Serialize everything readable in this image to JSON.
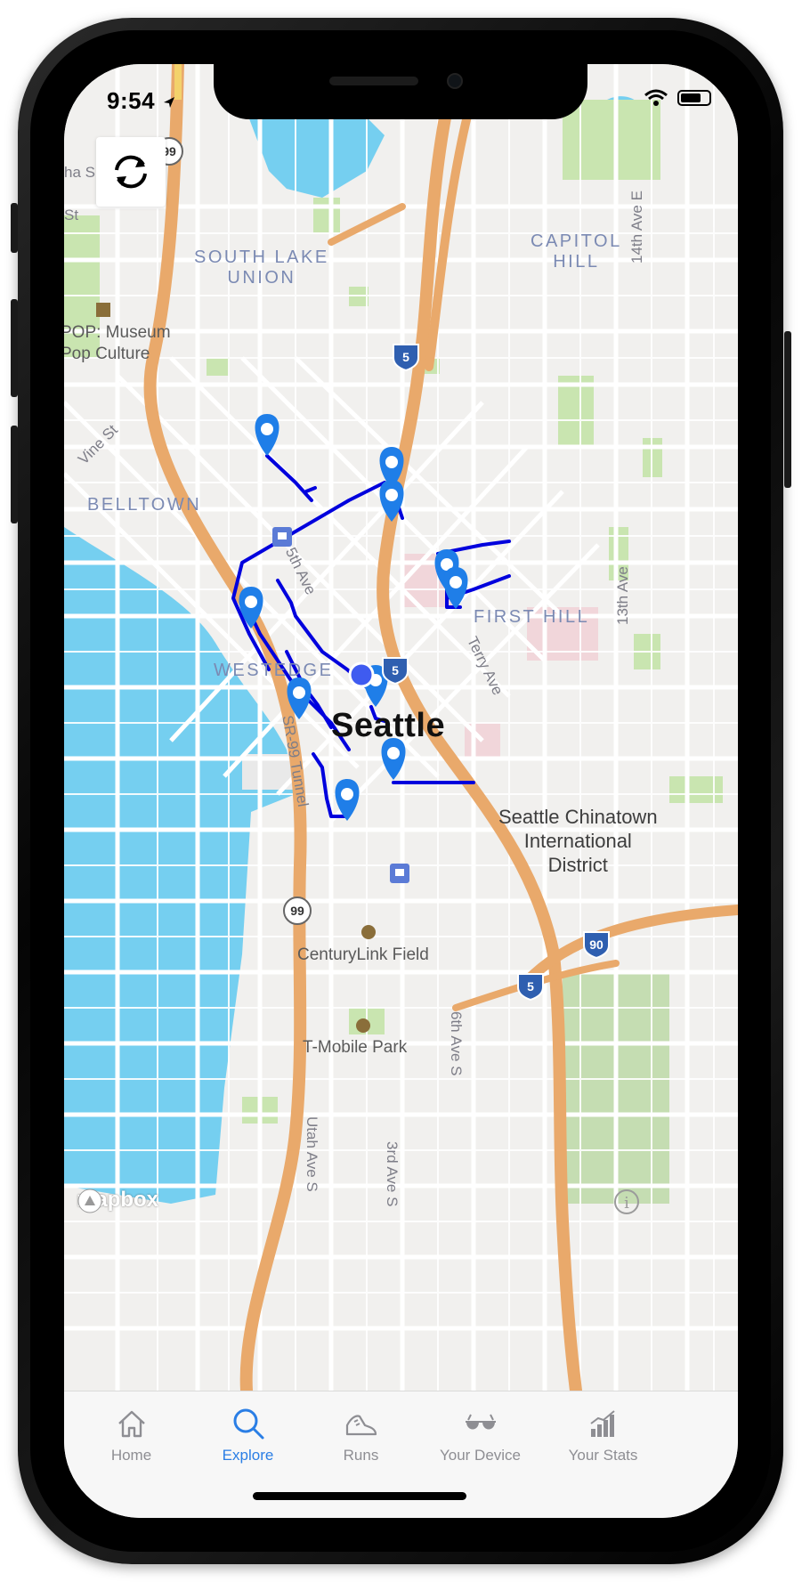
{
  "status_bar": {
    "time": "9:54"
  },
  "map": {
    "neighborhoods": [
      "SOUTH LAKE\nUNION",
      "CAPITOL\nHILL",
      "BELLTOWN",
      "FIRST HILL",
      "WESTEDGE"
    ],
    "streets": [
      "Vine St",
      "5th Ave",
      "Terry Ave",
      "13th Ave",
      "14th Ave E",
      "SR-99 Tunnel",
      "6th Ave S",
      "Utah Ave S",
      "3rd Ave S",
      "ha S",
      "St"
    ],
    "pois": [
      "POP: Museum\nPop Culture",
      "CenturyLink Field",
      "T-Mobile Park"
    ],
    "city_label": "Seattle",
    "district_label": "Seattle Chinatown\nInternational\nDistrict",
    "highway_shields": [
      "99",
      "5",
      "5",
      "99",
      "90",
      "5"
    ],
    "attribution": "mapbox",
    "info": "i"
  },
  "colors": {
    "accent": "#2a7ee5",
    "route": "#0000dd",
    "marker": "#1f7ee8",
    "highway": "#e9a96b",
    "water": "#75cff0",
    "park": "#c9e5b0"
  },
  "tabs": [
    {
      "label": "Home",
      "icon": "house-icon"
    },
    {
      "label": "Explore",
      "icon": "magnifier-icon",
      "active": true
    },
    {
      "label": "Runs",
      "icon": "shoe-icon"
    },
    {
      "label": "Your Device",
      "icon": "glasses-icon"
    },
    {
      "label": "Your Stats",
      "icon": "bar-chart-icon"
    }
  ]
}
